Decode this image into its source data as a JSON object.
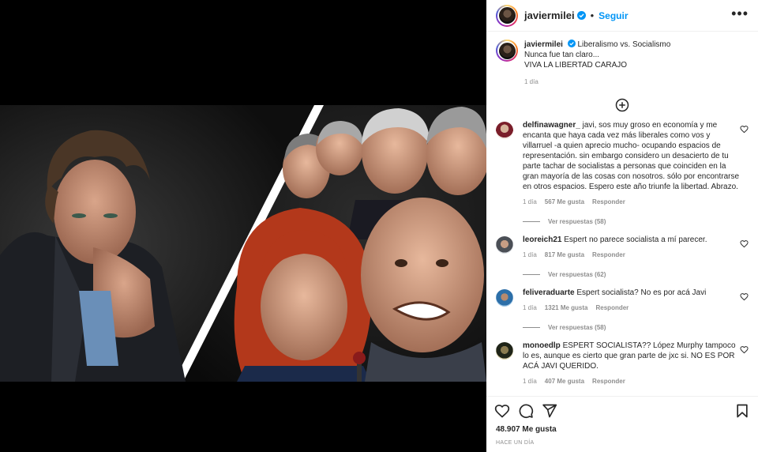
{
  "post": {
    "author": "javiermilei",
    "follow_label": "Seguir",
    "dot": "•",
    "more_label": "•••",
    "caption_lines": [
      "Liberalismo vs. Socialismo",
      "Nunca fue tan claro...",
      "VIVA LA LIBERTAD CARAJO"
    ],
    "caption_time": "1 día",
    "likes_total": "48.907 Me gusta",
    "time_ago": "HACE UN DÍA"
  },
  "comments": [
    {
      "user": "delfinawagner_",
      "text": "javi, sos muy groso en economía y me encanta que haya cada vez más liberales como vos y villarruel -a quien aprecio mucho- ocupando espacios de representación. sin embargo considero un desacierto de tu parte tachar de socialistas a personas que coinciden en la gran mayoría de las cosas con nosotros. sólo por encontrarse en otros espacios. Espero este año triunfe la libertad. Abrazo.",
      "time": "1 día",
      "likes": "567 Me gusta",
      "reply": "Responder",
      "replies": "Ver respuestas (58)"
    },
    {
      "user": "leoreich21",
      "text": "Espert no parece socialista a mí parecer.",
      "time": "1 día",
      "likes": "817 Me gusta",
      "reply": "Responder",
      "replies": "Ver respuestas (62)"
    },
    {
      "user": "feliveraduarte",
      "text": "Espert socialista? No es por acá Javi",
      "time": "1 día",
      "likes": "1321 Me gusta",
      "reply": "Responder",
      "replies": "Ver respuestas (58)"
    },
    {
      "user": "monoedlp",
      "text": "ESPERT SOCIALISTA?? López Murphy tampoco lo es, aunque es cierto que gran parte de jxc si. NO ES POR ACÁ JAVI QUERIDO.",
      "time": "1 día",
      "likes": "407 Me gusta",
      "reply": "Responder",
      "replies": ""
    }
  ],
  "icons": {
    "verified": "verified-badge-icon",
    "add": "add-circle-icon",
    "like": "heart-icon",
    "comment": "comment-bubble-icon",
    "share": "paper-plane-icon",
    "save": "bookmark-icon"
  },
  "colors": {
    "accent": "#0095f6",
    "muted": "#8e8e8e",
    "text": "#262626"
  }
}
